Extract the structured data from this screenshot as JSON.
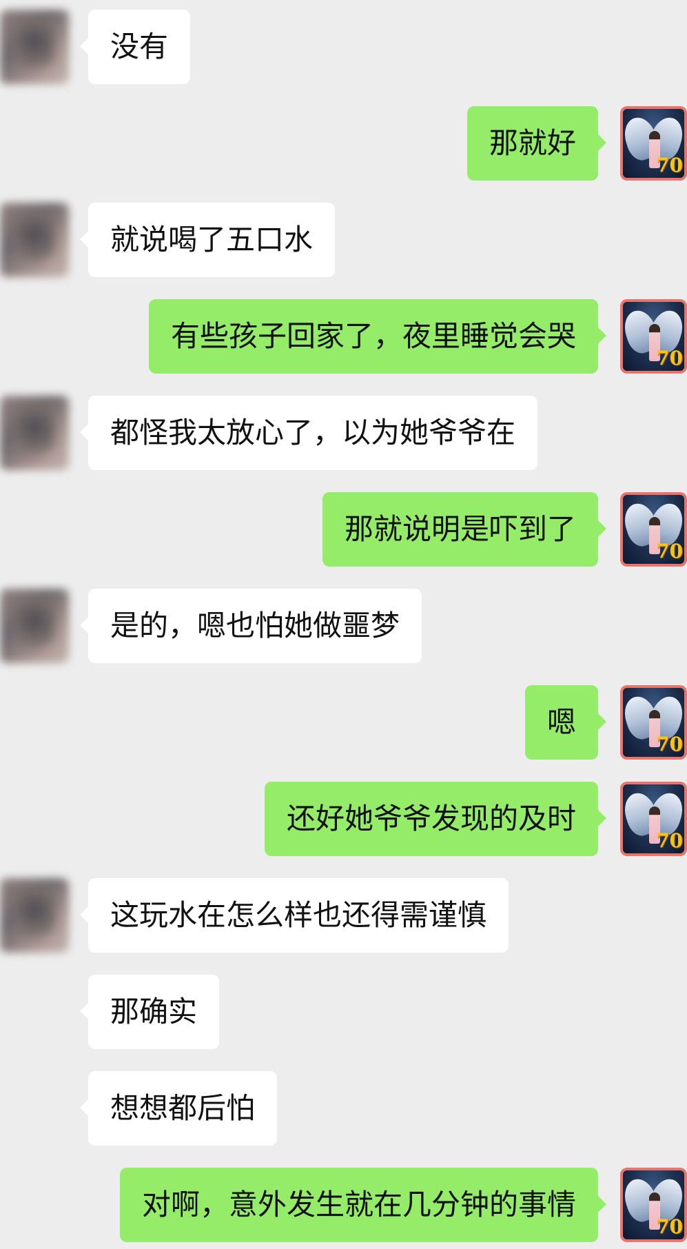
{
  "chat": {
    "colors": {
      "background": "#ededed",
      "received_bubble": "#ffffff",
      "sent_bubble": "#95ec69"
    },
    "sender_avatar": {
      "badge": "70",
      "icon": "angel-wings-avatar-icon"
    },
    "messages": [
      {
        "side": "left",
        "text": "没有"
      },
      {
        "side": "right",
        "text": "那就好"
      },
      {
        "side": "left",
        "text": "就说喝了五口水"
      },
      {
        "side": "right",
        "text": "有些孩子回家了，夜里睡觉会哭"
      },
      {
        "side": "left",
        "text": "都怪我太放心了，以为她爷爷在"
      },
      {
        "side": "right",
        "text": "那就说明是吓到了"
      },
      {
        "side": "left",
        "text": "是的，嗯也怕她做噩梦"
      },
      {
        "side": "right",
        "text": "嗯"
      },
      {
        "side": "right",
        "text": "还好她爷爷发现的及时"
      },
      {
        "side": "left",
        "text": "这玩水在怎么样也还得需谨慎"
      },
      {
        "side": "left",
        "text": "那确实"
      },
      {
        "side": "left",
        "text": "想想都后怕"
      },
      {
        "side": "right",
        "text": "对啊，意外发生就在几分钟的事情"
      }
    ]
  }
}
